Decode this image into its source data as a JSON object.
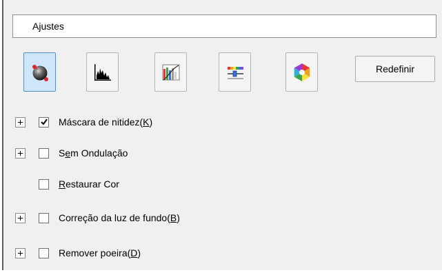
{
  "settings": {
    "title": "Ajustes",
    "tools": [
      {
        "name": "unsharp-mask-tool",
        "icon": "sphere-icon",
        "active": true
      },
      {
        "name": "histogram-tool",
        "icon": "histogram-icon",
        "active": false
      },
      {
        "name": "tone-curve-tool",
        "icon": "tone-curve-icon",
        "active": false
      },
      {
        "name": "image-adjustment-tool",
        "icon": "sliders-icon",
        "active": false
      },
      {
        "name": "color-palette-tool",
        "icon": "color-wheel-icon",
        "active": false
      }
    ],
    "reset_label": "Redefinir",
    "options": [
      {
        "pre": "Máscara de nitidez(",
        "key": "K",
        "post": ")",
        "checked": true,
        "expandable": true
      },
      {
        "pre": "S",
        "key": "e",
        "post": "m Ondulação",
        "checked": false,
        "expandable": true
      },
      {
        "pre": "",
        "key": "R",
        "post": "estaurar Cor",
        "checked": false,
        "expandable": false
      },
      {
        "pre": "Correção da luz de fundo(",
        "key": "B",
        "post": ")",
        "checked": false,
        "expandable": true
      },
      {
        "pre": "Remover poeira(",
        "key": "D",
        "post": ")",
        "checked": false,
        "expandable": true
      }
    ]
  }
}
